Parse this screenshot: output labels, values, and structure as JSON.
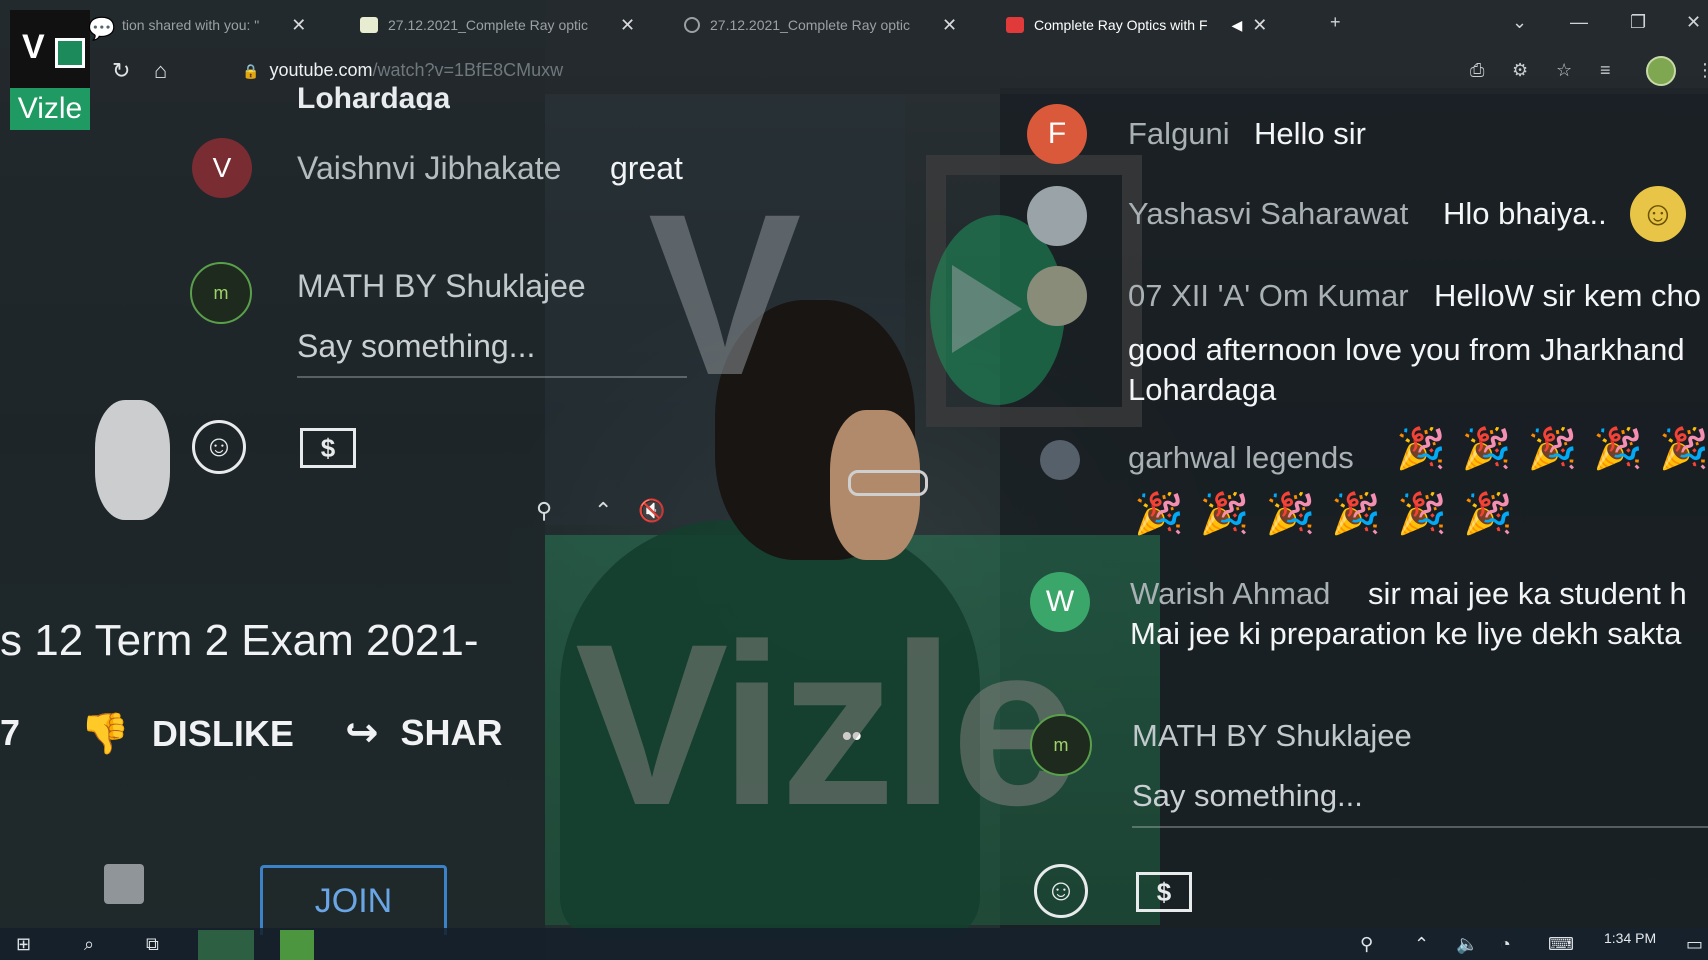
{
  "browser": {
    "tabs": [
      {
        "label": "tion shared with you: \""
      },
      {
        "label": "27.12.2021_Complete Ray optic"
      },
      {
        "label": "27.12.2021_Complete Ray optic"
      },
      {
        "label": "Complete Ray Optics with F"
      }
    ],
    "new_tab": "+",
    "url_domain": "youtube.com",
    "url_path": "/watch?v=1BfE8CMuxw"
  },
  "logo": {
    "top_letter": "V",
    "brand": "Vizle"
  },
  "left_chat": {
    "top_fragment": "Lohardaga",
    "messages": [
      {
        "avatar_letter": "V",
        "avatar_color": "#7a2c33",
        "name": "Vaishnvi Jibhakate",
        "text": "great"
      }
    ],
    "channel_name": "MATH BY Shuklajee",
    "input_placeholder": "Say something...",
    "dollar_label": "$"
  },
  "video": {
    "title": "s 12 Term 2 Exam 2021-",
    "like_count": "7",
    "dislike_label": "DISLIKE",
    "share_label": "SHAR",
    "join_label": "JOIN",
    "more_label": "••"
  },
  "right_chat": {
    "messages": [
      {
        "avatar_letter": "F",
        "avatar_color": "#d9593a",
        "name": "Falguni",
        "text": "Hello sir"
      },
      {
        "avatar_letter": "",
        "avatar_color": "#9aa3a8",
        "name": "Yashasvi Saharawat",
        "text": "Hlo bhaiya..",
        "emoji": "smile-emoji"
      },
      {
        "avatar_letter": "",
        "avatar_color": "#8a8c7a",
        "name": "07 XII 'A' Om Kumar",
        "text": "HelloW sir kem cho"
      },
      {
        "text_line1": "good afternoon love you from Jharkhand",
        "text_line2": "Lohardaga"
      },
      {
        "avatar_letter": "",
        "avatar_color": "#55606a",
        "name": "garhwal legends",
        "party_row1": "🎉🎉🎉🎉🎉",
        "party_row2": "🎉🎉🎉🎉🎉🎉"
      },
      {
        "avatar_letter": "W",
        "avatar_color": "#3aa66a",
        "name": "Warish Ahmad",
        "text": "sir mai jee ka student h",
        "text_line2": "Mai jee ki preparation ke liye dekh sakta"
      }
    ],
    "channel_name": "MATH BY Shuklajee",
    "input_placeholder": "Say something...",
    "dollar_label": "$"
  },
  "taskbar": {
    "time": "1:34 PM"
  },
  "watermark": {
    "letter": "V",
    "text": "Vizle"
  }
}
